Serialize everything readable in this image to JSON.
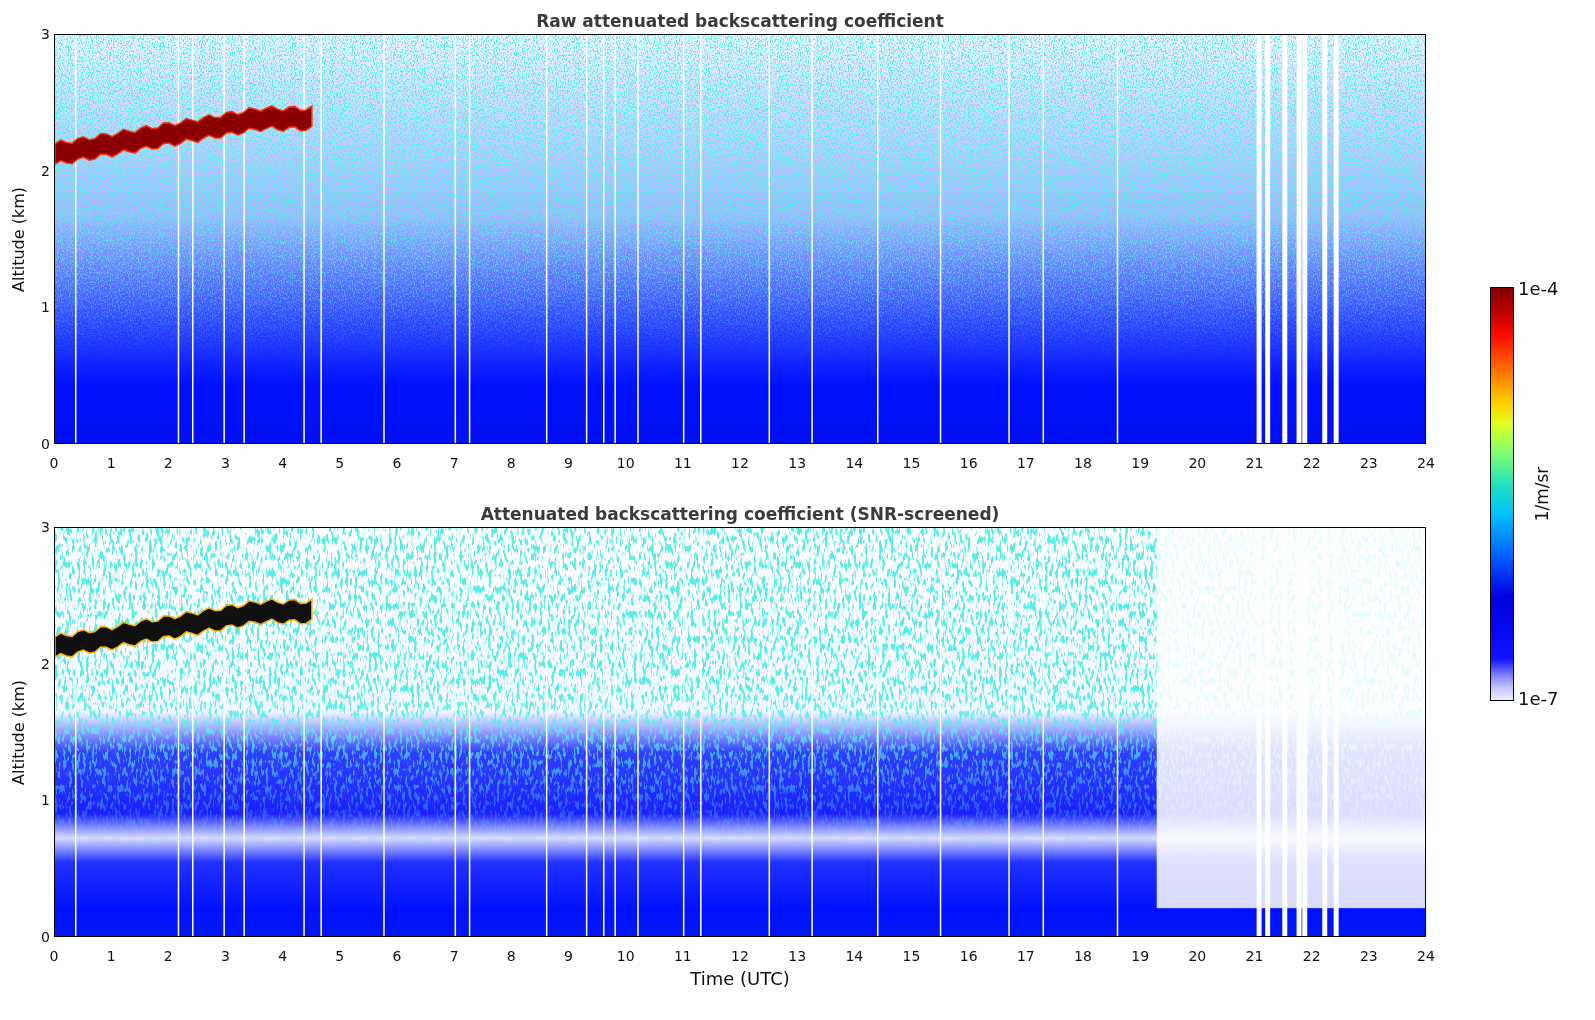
{
  "panels": [
    {
      "kind": "raw",
      "title": "Raw attenuated backscattering coefficient",
      "ylabel": "Altitude (km)",
      "yticks": [
        "3",
        "2",
        "1",
        "0"
      ],
      "xticks": [
        "0",
        "1",
        "2",
        "3",
        "4",
        "5",
        "6",
        "7",
        "8",
        "9",
        "10",
        "11",
        "12",
        "13",
        "14",
        "15",
        "16",
        "17",
        "18",
        "19",
        "20",
        "21",
        "22",
        "23",
        "24"
      ]
    },
    {
      "kind": "screened",
      "title": "Attenuated backscattering coefficient (SNR-screened)",
      "ylabel": "Altitude (km)",
      "yticks": [
        "3",
        "2",
        "1",
        "0"
      ],
      "xticks": [
        "0",
        "1",
        "2",
        "3",
        "4",
        "5",
        "6",
        "7",
        "8",
        "9",
        "10",
        "11",
        "12",
        "13",
        "14",
        "15",
        "16",
        "17",
        "18",
        "19",
        "20",
        "21",
        "22",
        "23",
        "24"
      ]
    }
  ],
  "xlabel": "Time (UTC)",
  "colorbar": {
    "max_label": "1e-4",
    "min_label": "1e-7",
    "unit": "1/m/sr"
  }
}
